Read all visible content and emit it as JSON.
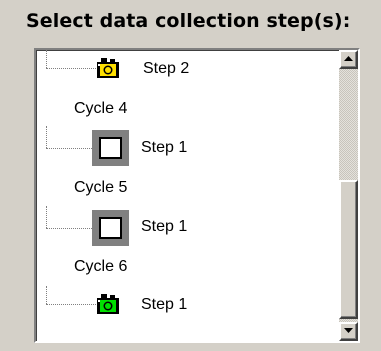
{
  "heading": "Select data collection step(s):",
  "tree": {
    "nodes": [
      {
        "label": "Step 2",
        "icon": "camera-icon-yellow"
      },
      {
        "label": "Cycle 4"
      },
      {
        "label": "Step 1",
        "icon": "empty-square-icon"
      },
      {
        "label": "Cycle 5"
      },
      {
        "label": "Step 1",
        "icon": "empty-square-icon"
      },
      {
        "label": "Cycle 6"
      },
      {
        "label": "Step 1",
        "icon": "camera-icon-green"
      }
    ]
  },
  "scrollbar": {
    "position_fraction": 1.0,
    "icons": {
      "up": "up-arrow-icon",
      "down": "down-arrow-icon"
    }
  },
  "colors": {
    "face": "#d4d0c8",
    "camera_yellow": "#ffe000",
    "camera_green": "#00e000",
    "square_border": "#808080"
  }
}
